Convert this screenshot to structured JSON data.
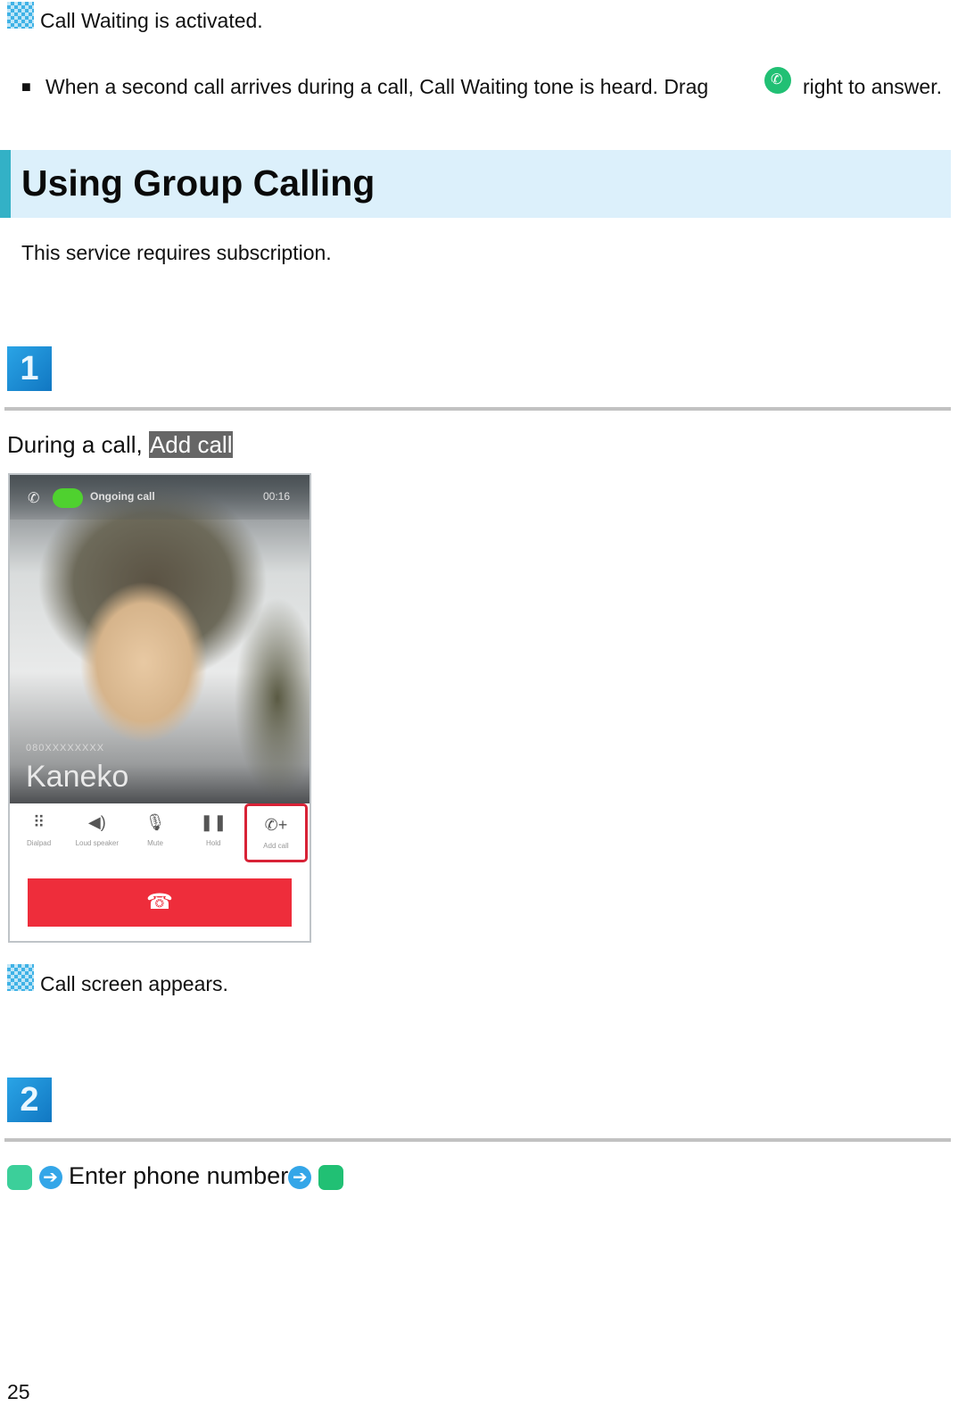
{
  "intro": {
    "result_text": "Call Waiting is activated.",
    "note_bullet": "■",
    "note_before_icon": "When a second call arrives during a call, Call Waiting tone is heard. Drag",
    "note_after_icon": "right to answer."
  },
  "section": {
    "title": "Using Group Calling",
    "subtitle": "This service requires subscription."
  },
  "steps": [
    {
      "number": "1",
      "instruction_prefix": "During a call, ",
      "instruction_highlight": "Add call",
      "result_text": "Call screen appears.",
      "phone_screen": {
        "status_label": "Ongoing call",
        "status_time": "00:16",
        "caller_number": "080XXXXXXXX",
        "caller_name": "Kaneko",
        "actions": [
          {
            "icon": "dialpad-icon",
            "glyph": "⠿",
            "label": "Dialpad"
          },
          {
            "icon": "speaker-icon",
            "glyph": "◀)",
            "label": "Loud speaker"
          },
          {
            "icon": "mute-icon",
            "glyph": "🎙",
            "label": "Mute"
          },
          {
            "icon": "hold-icon",
            "glyph": "❚❚",
            "label": "Hold"
          },
          {
            "icon": "add-call-icon",
            "glyph": "✆+",
            "label": "Add call"
          }
        ],
        "end_call_glyph": "☎"
      }
    },
    {
      "number": "2",
      "instruction_text": "Enter phone number",
      "arrow_glyph": "➔"
    }
  ],
  "footer": {
    "page_number": "25"
  },
  "colors": {
    "heading_band": "#dcf0fb",
    "heading_accent": "#33b1c6",
    "answer_green": "#21c074",
    "end_call_red": "#ee2d3b",
    "highlight_gray": "#666666"
  }
}
